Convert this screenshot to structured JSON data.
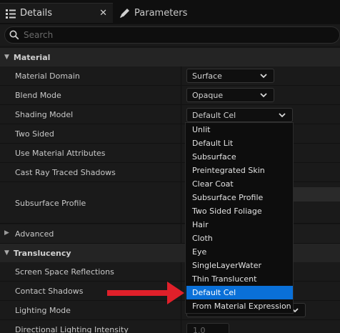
{
  "tabs": [
    {
      "label": "Details",
      "icon": "details-list-icon",
      "active": true,
      "close": "✕"
    },
    {
      "label": "Parameters",
      "icon": "parameters-pencil-icon",
      "active": false
    }
  ],
  "search": {
    "placeholder": "Search",
    "value": ""
  },
  "categories": {
    "material": "Material",
    "advanced": "Advanced",
    "translucency": "Translucency"
  },
  "properties": {
    "material_domain": {
      "label": "Material Domain",
      "value": "Surface"
    },
    "blend_mode": {
      "label": "Blend Mode",
      "value": "Opaque"
    },
    "shading_model": {
      "label": "Shading Model",
      "value": "Default Cel"
    },
    "two_sided": {
      "label": "Two Sided"
    },
    "use_material_attributes": {
      "label": "Use Material Attributes"
    },
    "cast_ray_traced_shadows": {
      "label": "Cast Ray Traced Shadows"
    },
    "subsurface_profile": {
      "label": "Subsurface Profile"
    },
    "screen_space_reflections": {
      "label": "Screen Space Reflections"
    },
    "contact_shadows": {
      "label": "Contact Shadows"
    },
    "lighting_mode": {
      "label": "Lighting Mode"
    },
    "directional_lighting_intensity": {
      "label": "Directional Lighting Intensity",
      "value": "1.0"
    }
  },
  "dropdown": {
    "options": [
      "Unlit",
      "Default Lit",
      "Subsurface",
      "Preintegrated Skin",
      "Clear Coat",
      "Subsurface Profile",
      "Two Sided Foliage",
      "Hair",
      "Cloth",
      "Eye",
      "SingleLayerWater",
      "Thin Translucent",
      "Default Cel",
      "From Material Expression"
    ],
    "selected_index": 12
  },
  "colors": {
    "selection": "#0a70d8",
    "annotation_arrow": "#e0202a",
    "panel_bg": "#1a1a1a"
  }
}
